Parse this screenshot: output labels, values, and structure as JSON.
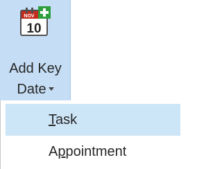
{
  "ribbon_button": {
    "label_line1": "Add Key",
    "label_line2": "Date",
    "icon": "calendar-add-icon",
    "icon_month": "NOV",
    "icon_day": "10",
    "colors": {
      "background": "#c5def5",
      "calendar_red": "#c42b1c",
      "plus_green": "#2e9e3e"
    }
  },
  "menu": {
    "items": [
      {
        "label_underlined": "T",
        "label_rest": "ask",
        "highlighted": true
      },
      {
        "label_first": "A",
        "label_underlined": "p",
        "label_rest": "pointment",
        "highlighted": false
      }
    ],
    "colors": {
      "highlight": "#cde6f7"
    }
  }
}
